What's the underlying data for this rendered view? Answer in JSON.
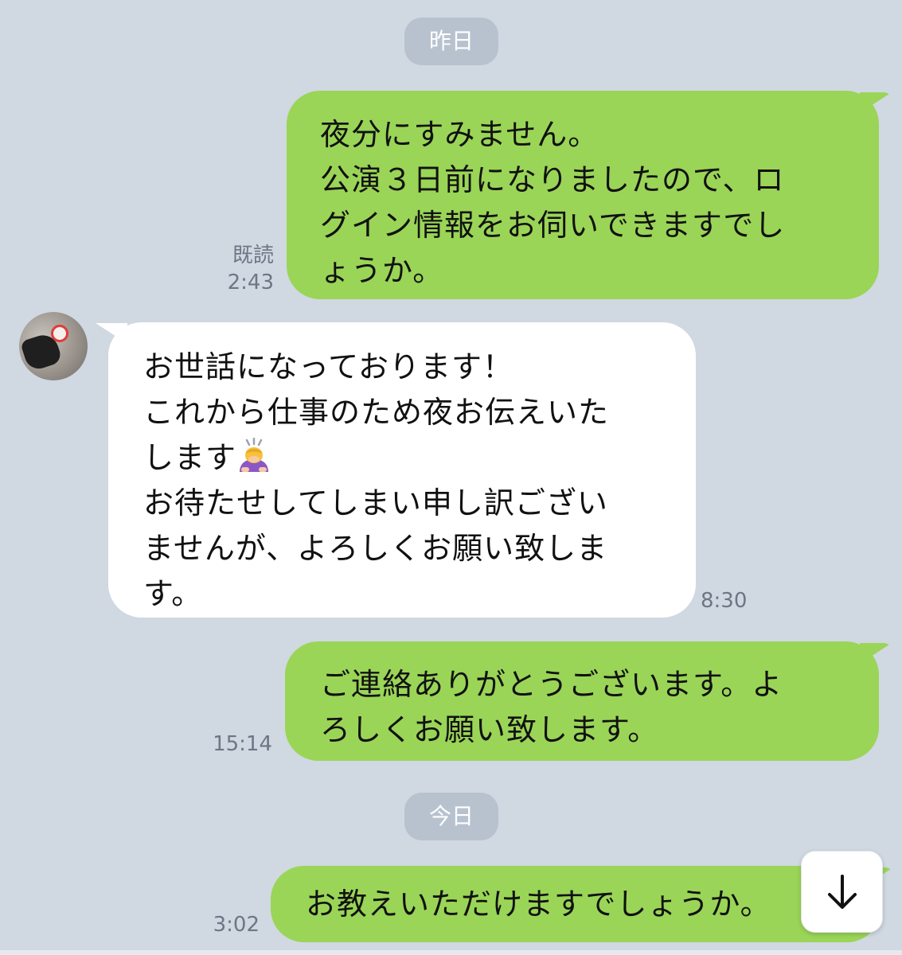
{
  "dates": {
    "yesterday": "昨日",
    "today": "今日"
  },
  "messages": [
    {
      "direction": "outgoing",
      "read_label": "既読",
      "time": "2:43",
      "text": "夜分にすみません。\n公演３日前になりましたので、ロ\nグイン情報をお伺いできますでし\nょうか。"
    },
    {
      "direction": "incoming",
      "time": "8:30",
      "text_before_emoji": "お世話になっております！\nこれから仕事のため夜お伝えいた\nします",
      "emoji": "person-bowing-emoji",
      "text_after_emoji": "\nお待たせしてしまい申し訳ござい\nませんが、よろしくお願い致しま\nす。"
    },
    {
      "direction": "outgoing",
      "time": "15:14",
      "text": "ご連絡ありがとうございます。よ\nろしくお願い致します。"
    },
    {
      "direction": "outgoing",
      "time": "3:02",
      "text": "お教えいただけますでしょうか。"
    }
  ],
  "icons": {
    "scroll_down": "arrow-down-icon",
    "avatar": "avatar"
  },
  "colors": {
    "background": "#d0d8e2",
    "outgoing_bubble": "#9ad557",
    "incoming_bubble": "#ffffff",
    "date_pill": "#b8c2cf",
    "meta_text": "#6d7784"
  }
}
